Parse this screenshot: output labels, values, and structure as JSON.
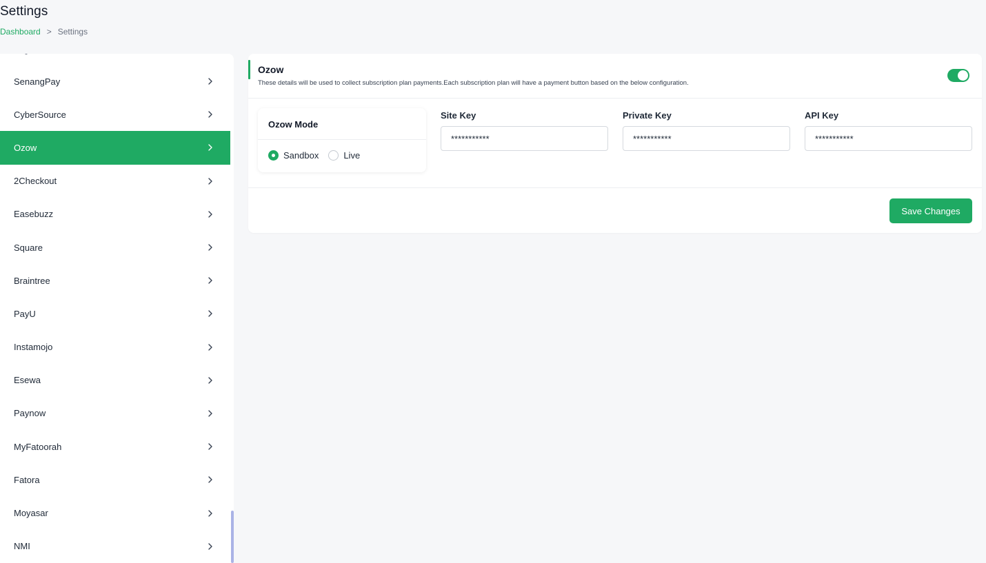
{
  "header": {
    "title": "Settings",
    "breadcrumb": {
      "home": "Dashboard",
      "separator": ">",
      "current": "Settings"
    }
  },
  "sidebar": {
    "items": [
      {
        "label": "SenangPay",
        "active": false
      },
      {
        "label": "CyberSource",
        "active": false
      },
      {
        "label": "Ozow",
        "active": true
      },
      {
        "label": "2Checkout",
        "active": false
      },
      {
        "label": "Easebuzz",
        "active": false
      },
      {
        "label": "Square",
        "active": false
      },
      {
        "label": "Braintree",
        "active": false
      },
      {
        "label": "PayU",
        "active": false
      },
      {
        "label": "Instamojo",
        "active": false
      },
      {
        "label": "Esewa",
        "active": false
      },
      {
        "label": "Paynow",
        "active": false
      },
      {
        "label": "MyFatoorah",
        "active": false
      },
      {
        "label": "Fatora",
        "active": false
      },
      {
        "label": "Moyasar",
        "active": false
      },
      {
        "label": "NMI",
        "active": false
      }
    ]
  },
  "card": {
    "title": "Ozow",
    "description": "These details will be used to collect subscription plan payments.Each subscription plan will have a payment button based on the below configuration.",
    "enabled": true,
    "mode": {
      "title": "Ozow Mode",
      "options": [
        "Sandbox",
        "Live"
      ],
      "selected": "Sandbox"
    },
    "fields": [
      {
        "label": "Site Key",
        "value": "***********"
      },
      {
        "label": "Private Key",
        "value": "***********"
      },
      {
        "label": "API Key",
        "value": "***********"
      }
    ],
    "save_label": "Save Changes"
  },
  "colors": {
    "accent": "#1faa63",
    "scrollbar": "#aab3e6"
  }
}
